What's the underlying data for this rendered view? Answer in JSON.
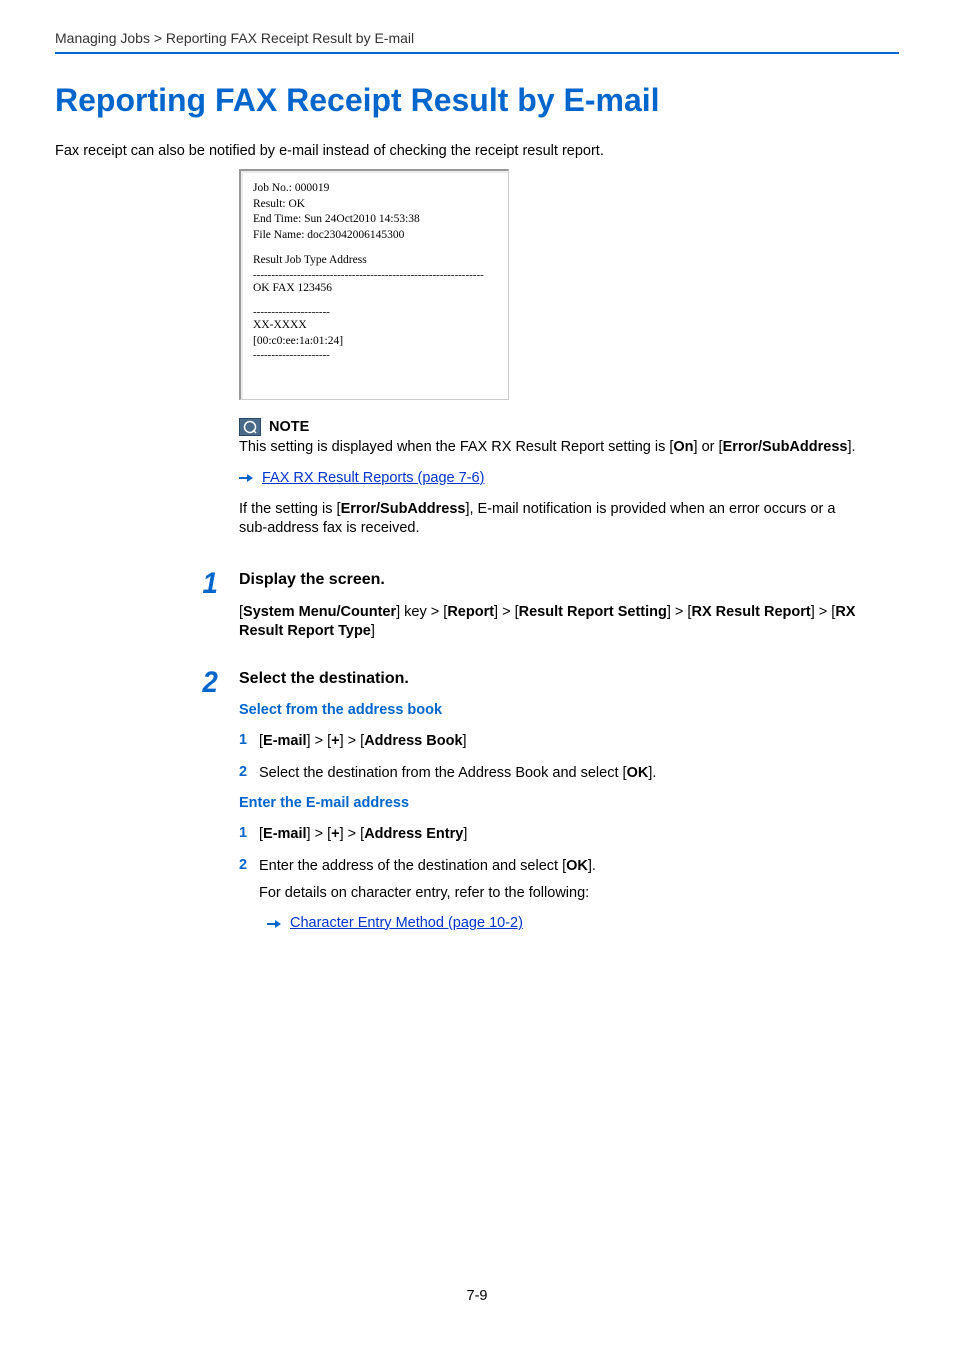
{
  "breadcrumb": {
    "section": "Managing Jobs",
    "separator": " > ",
    "topic": "Reporting FAX Receipt Result by E-mail"
  },
  "title": "Reporting FAX Receipt Result by E-mail",
  "intro": "Fax receipt can also be notified by e-mail instead of checking the receipt result report.",
  "email_sample": {
    "line1": "Job No.:  000019",
    "line2": "Result:  OK",
    "line3": "End Time:  Sun 24Oct2010 14:53:38",
    "line4": "File Name:  doc23042006145300",
    "header": "Result  Job Type  Address",
    "dash1": "---------------------------------------------------------------",
    "row": "  OK    FAX        123456",
    "dash2": "---------------------",
    "model": "XX-XXXX",
    "mac": "[00:c0:ee:1a:01:24]",
    "dash3": "---------------------"
  },
  "note": {
    "label": "NOTE",
    "body_prefix": "This setting is displayed when the FAX RX Result Report setting is [",
    "opt_on": "On",
    "body_mid": "] or [",
    "opt_err": "Error/SubAddress",
    "body_suffix": "].",
    "link": "FAX RX Result Reports (page 7-6)",
    "body2_prefix": "If the setting is [",
    "body2_bold": "Error/SubAddress",
    "body2_suffix": "], E-mail notification is provided when an error occurs or a sub-address fax is received."
  },
  "step1": {
    "num": "1",
    "title": "Display the screen.",
    "p1": "[",
    "b1": "System Menu/Counter",
    "p2": "] key > [",
    "b2": "Report",
    "p3": "] > [",
    "b3": "Result Report Setting",
    "p4": "] > [",
    "b4": "RX Result Report",
    "p5": "] > [",
    "b5": "RX Result Report Type",
    "p6": "]"
  },
  "step2": {
    "num": "2",
    "title": "Select the destination.",
    "groupA": {
      "heading": "Select from the address book",
      "s1": {
        "num": "1",
        "p1": "[",
        "b1": "E-mail",
        "p2": "] > [",
        "b2": "+",
        "p3": "] > [",
        "b3": "Address Book",
        "p4": "]"
      },
      "s2": {
        "num": "2",
        "prefix": "Select the destination from the Address Book and select [",
        "bold": "OK",
        "suffix": "]."
      }
    },
    "groupB": {
      "heading": "Enter the E-mail address",
      "s1": {
        "num": "1",
        "p1": "[",
        "b1": "E-mail",
        "p2": "] > [",
        "b2": "+",
        "p3": "] > [",
        "b3": "Address Entry",
        "p4": "]"
      },
      "s2": {
        "num": "2",
        "prefix": "Enter the address of the destination and select [",
        "bold": "OK",
        "suffix": "].",
        "extra": "For details on character entry, refer to the following:",
        "link": "Character Entry Method (page 10-2)"
      }
    }
  },
  "page_number": "7-9"
}
